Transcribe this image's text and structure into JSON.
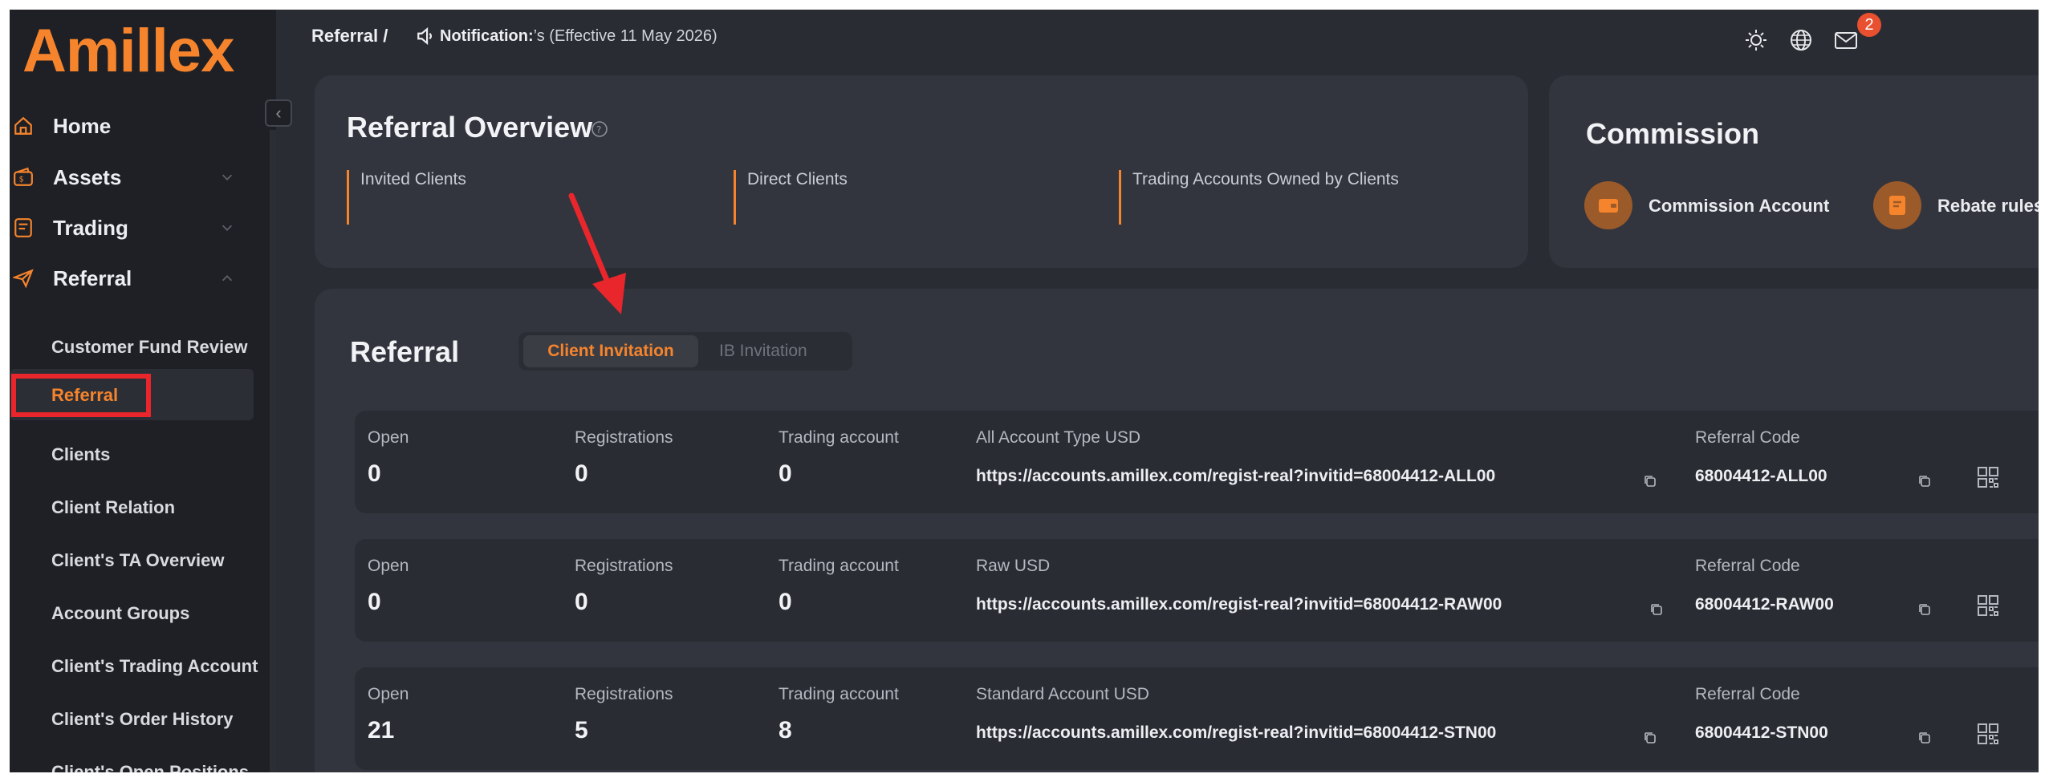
{
  "brand": {
    "logo_text": "Amillex",
    "accent": "#f5842c"
  },
  "sidebar": {
    "items": [
      {
        "label": "Home",
        "icon": "home-icon"
      },
      {
        "label": "Assets",
        "icon": "wallet-icon"
      },
      {
        "label": "Trading",
        "icon": "trading-icon"
      },
      {
        "label": "Referral",
        "icon": "paper-plane-icon"
      }
    ],
    "referral_sub": [
      "Customer Fund Review",
      "Referral",
      "Clients",
      "Client Relation",
      "Client's TA Overview",
      "Account Groups",
      "Client's Trading Account",
      "Client's Order History",
      "Client's Open Positions"
    ],
    "active_sub": "Referral"
  },
  "topbar": {
    "breadcrumb": "Referral /",
    "notification_label": "Notification:",
    "notification_text": "’s (Effective 11 May 2026)",
    "mail_badge": "2"
  },
  "overview": {
    "title": "Referral Overview",
    "metrics": [
      "Invited Clients",
      "Direct Clients",
      "Trading Accounts Owned by Clients"
    ]
  },
  "commission": {
    "title": "Commission",
    "account_label": "Commission Account",
    "rebate_label": "Rebate rules",
    "rebate_chevron": ">"
  },
  "referral": {
    "title": "Referral",
    "tabs": {
      "active": "Client Invitation",
      "inactive": "IB Invitation"
    },
    "rows": [
      {
        "open_label": "Open",
        "open": "0",
        "reg_label": "Registrations",
        "registrations": "0",
        "ta_label": "Trading account",
        "trading_account": "0",
        "type": "All Account Type USD",
        "url": "https://accounts.amillex.com/regist-real?invitid=68004412-ALL00",
        "code_label": "Referral Code",
        "code": "68004412-ALL00"
      },
      {
        "open_label": "Open",
        "open": "0",
        "reg_label": "Registrations",
        "registrations": "0",
        "ta_label": "Trading account",
        "trading_account": "0",
        "type": "Raw USD",
        "url": "https://accounts.amillex.com/regist-real?invitid=68004412-RAW00",
        "code_label": "Referral Code",
        "code": "68004412-RAW00"
      },
      {
        "open_label": "Open",
        "open": "21",
        "reg_label": "Registrations",
        "registrations": "5",
        "ta_label": "Trading account",
        "trading_account": "8",
        "type": "Standard Account USD",
        "url": "https://accounts.amillex.com/regist-real?invitid=68004412-STN00",
        "code_label": "Referral Code",
        "code": "68004412-STN00"
      }
    ]
  }
}
